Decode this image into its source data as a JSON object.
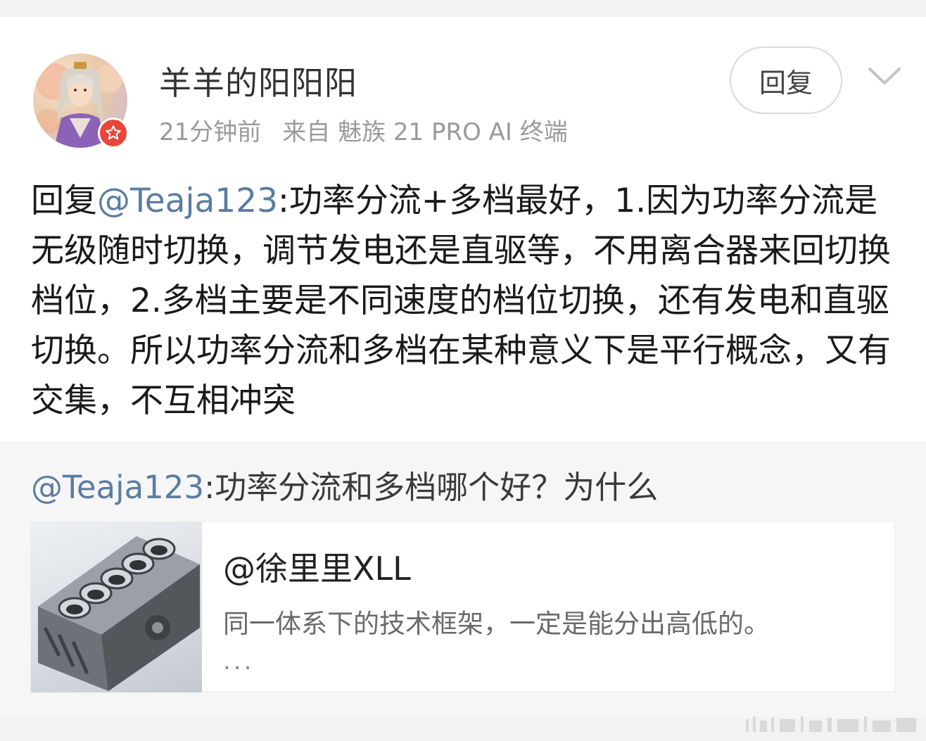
{
  "post": {
    "username": "羊羊的阳阳阳",
    "time": "21分钟前",
    "source": "来自 魅族 21 PRO AI 终端",
    "reply_button": "回复",
    "body": {
      "prefix": "回复",
      "mention": "@Teaja123",
      "text": ":功率分流+多档最好，1.因为功率分流是无级随时切换，调节发电还是直驱等，不用离合器来回切换档位，2.多档主要是不同速度的档位切换，还有发电和直驱切换。所以功率分流和多档在某种意义下是平行概念，又有交集，不互相冲突"
    }
  },
  "quote": {
    "mention": "@Teaja123",
    "text": ":功率分流和多档哪个好？为什么",
    "link_card": {
      "title": "@徐里里XLL",
      "description": "同一体系下的技术框架，一定是能分出高低的。",
      "more": "..."
    }
  },
  "colors": {
    "mention": "#5b7ca3",
    "badge": "#e8463a",
    "background": "#f2f2f2",
    "quote_background": "#f6f6f6"
  },
  "icons": {
    "badge": "star-icon",
    "menu": "chevron-down-icon"
  }
}
